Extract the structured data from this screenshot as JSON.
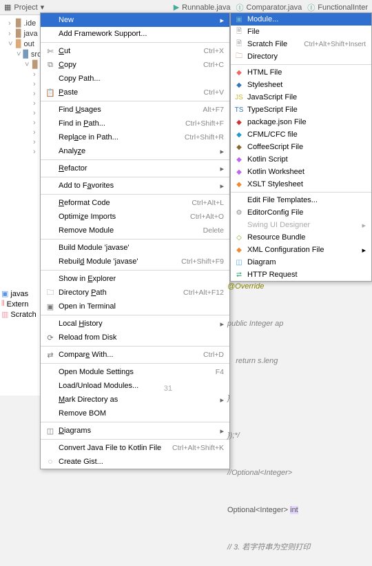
{
  "toolbar": {
    "project_label": "Project",
    "tab1": "Runnable.java",
    "tab2": "Comparator.java",
    "tab3": "FunctionalInter"
  },
  "tree": {
    "idea": ".ide",
    "javase": "java",
    "out": "out",
    "src": "src"
  },
  "lower": {
    "javase": "javas",
    "external": "Extern",
    "scratch": "Scratch"
  },
  "menu1": {
    "new": "New",
    "add_framework": "Add Framework Support...",
    "cut": "Cut",
    "cut_sc": "Ctrl+X",
    "copy": "Copy",
    "copy_sc": "Ctrl+C",
    "copy_path": "Copy Path...",
    "paste": "Paste",
    "paste_sc": "Ctrl+V",
    "find_usages": "Find Usages",
    "find_usages_sc": "Alt+F7",
    "find_in_path": "Find in Path...",
    "find_in_path_sc": "Ctrl+Shift+F",
    "replace_in_path": "Replace in Path...",
    "replace_in_path_sc": "Ctrl+Shift+R",
    "analyze": "Analyze",
    "refactor": "Refactor",
    "add_favorites": "Add to Favorites",
    "reformat": "Reformat Code",
    "reformat_sc": "Ctrl+Alt+L",
    "optimize": "Optimize Imports",
    "optimize_sc": "Ctrl+Alt+O",
    "remove_module": "Remove Module",
    "remove_module_sc": "Delete",
    "build_module": "Build Module 'javase'",
    "rebuild_module": "Rebuild Module 'javase'",
    "rebuild_sc": "Ctrl+Shift+F9",
    "show_explorer": "Show in Explorer",
    "directory_path": "Directory Path",
    "directory_path_sc": "Ctrl+Alt+F12",
    "open_terminal": "Open in Terminal",
    "local_history": "Local History",
    "reload_disk": "Reload from Disk",
    "compare_with": "Compare With...",
    "compare_sc": "Ctrl+D",
    "open_module": "Open Module Settings",
    "open_module_sc": "F4",
    "load_unload": "Load/Unload Modules...",
    "mark_dir": "Mark Directory as",
    "remove_bom": "Remove BOM",
    "diagrams": "Diagrams",
    "convert_kotlin": "Convert Java File to Kotlin File",
    "convert_sc": "Ctrl+Alt+Shift+K",
    "create_gist": "Create Gist..."
  },
  "menu2": {
    "module": "Module...",
    "file": "File",
    "scratch_file": "Scratch File",
    "scratch_sc": "Ctrl+Alt+Shift+Insert",
    "directory": "Directory",
    "html": "HTML File",
    "stylesheet": "Stylesheet",
    "javascript": "JavaScript File",
    "typescript": "TypeScript File",
    "package_json": "package.json File",
    "cfml": "CFML/CFC file",
    "coffeescript": "CoffeeScript File",
    "kotlin_script": "Kotlin Script",
    "kotlin_worksheet": "Kotlin Worksheet",
    "xslt": "XSLT Stylesheet",
    "edit_templates": "Edit File Templates...",
    "editorconfig": "EditorConfig File",
    "swing": "Swing UI Designer",
    "resource_bundle": "Resource Bundle",
    "xml_config": "XML Configuration File",
    "diagram": "Diagram",
    "http": "HTTP Request"
  },
  "code": {
    "l1": "@Override",
    "l2": "public Integer ap",
    "l3": "    return s.leng",
    "l4": "}",
    "l5": "});*/",
    "l6": "//Optional<Integer>",
    "l7a": "Optional<Integer> ",
    "l7b": "int",
    "l8": "// 3. 若字符串为空则打印"
  },
  "gutter": {
    "n": "31"
  }
}
